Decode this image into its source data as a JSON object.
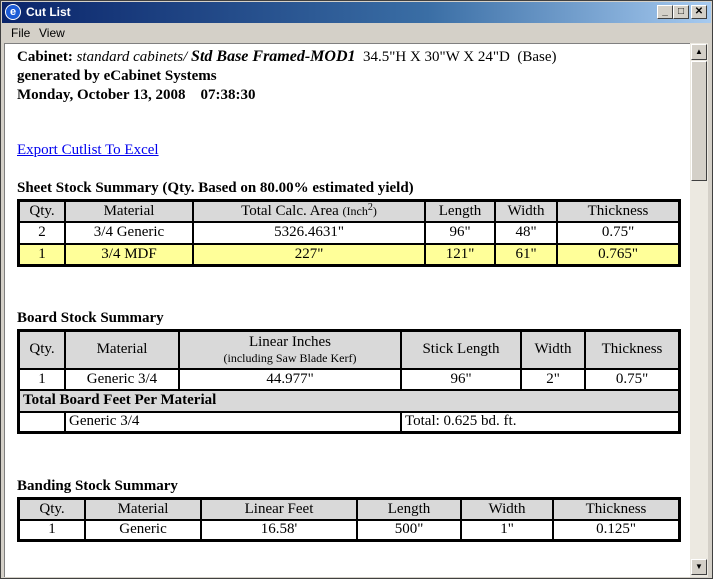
{
  "window": {
    "title": "Cut List"
  },
  "menu": {
    "file": "File",
    "view": "View"
  },
  "header": {
    "cabinet_label": "Cabinet:",
    "cabinet_path": "standard cabinets/",
    "cabinet_name": "Std Base Framed-MOD1",
    "cabinet_dims": "34.5\"H X 30\"W X 24\"D  (Base)",
    "generated_by": "generated by eCabinet Systems",
    "date": "Monday, October 13, 2008",
    "time": "07:38:30"
  },
  "export_link": "Export Cutlist To Excel",
  "sheet": {
    "title": "Sheet Stock Summary (Qty. Based on 80.00% estimated yield)",
    "headers": {
      "qty": "Qty.",
      "material": "Material",
      "area": "Total Calc. Area",
      "area_unit": "(Inch",
      "area_sup": "2",
      "area_close": ")",
      "length": "Length",
      "width": "Width",
      "thickness": "Thickness"
    },
    "rows": [
      {
        "qty": "2",
        "material": "3/4 Generic",
        "area": "5326.4631\"",
        "length": "96\"",
        "width": "48\"",
        "thickness": "0.75\""
      },
      {
        "qty": "1",
        "material": "3/4 MDF",
        "area": "227\"",
        "length": "121\"",
        "width": "61\"",
        "thickness": "0.765\""
      }
    ]
  },
  "board": {
    "title": "Board Stock Summary",
    "headers": {
      "qty": "Qty.",
      "material": "Material",
      "linear": "Linear Inches",
      "linear_sub": "(including Saw Blade Kerf)",
      "stick": "Stick Length",
      "width": "Width",
      "thickness": "Thickness"
    },
    "rows": [
      {
        "qty": "1",
        "material": "Generic 3/4",
        "linear": "44.977\"",
        "stick": "96\"",
        "width": "2\"",
        "thickness": "0.75\""
      }
    ],
    "feet_title": "Total Board Feet Per Material",
    "feet_rows": [
      {
        "material": "Generic 3/4",
        "total": "Total: 0.625 bd. ft."
      }
    ]
  },
  "banding": {
    "title": "Banding Stock Summary",
    "headers": {
      "qty": "Qty.",
      "material": "Material",
      "linear": "Linear Feet",
      "length": "Length",
      "width": "Width",
      "thickness": "Thickness"
    },
    "rows": [
      {
        "qty": "1",
        "material": "Generic",
        "linear": "16.58'",
        "length": "500\"",
        "width": "1\"",
        "thickness": "0.125\""
      }
    ]
  }
}
